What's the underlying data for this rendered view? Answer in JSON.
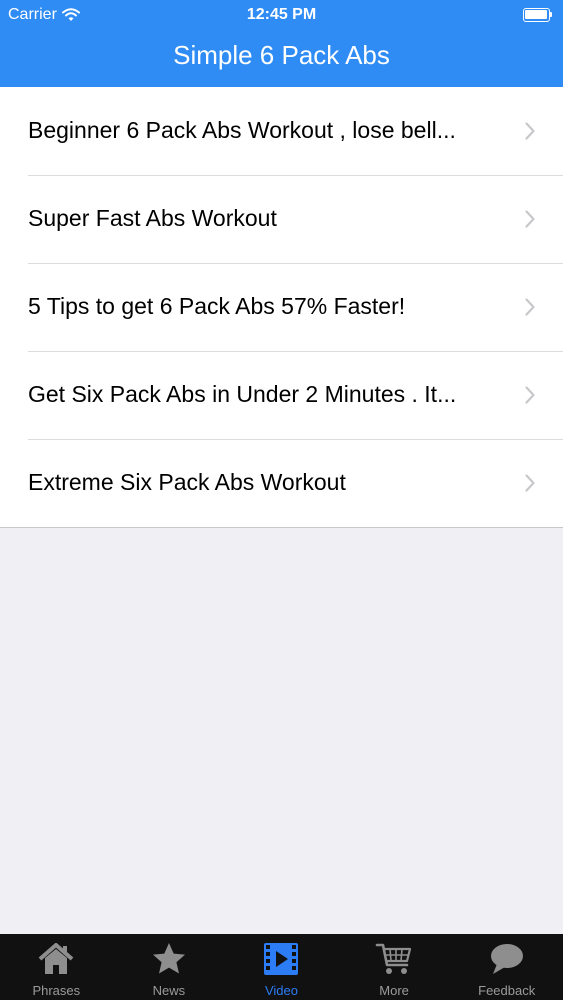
{
  "status_bar": {
    "carrier": "Carrier",
    "time": "12:45 PM"
  },
  "nav": {
    "title": "Simple 6 Pack Abs"
  },
  "list": {
    "items": [
      {
        "label": "Beginner 6 Pack Abs Workout , lose bell..."
      },
      {
        "label": "Super Fast Abs Workout"
      },
      {
        "label": "5 Tips to get 6 Pack Abs 57% Faster!"
      },
      {
        "label": "Get Six Pack Abs in Under 2 Minutes . It..."
      },
      {
        "label": "Extreme Six Pack Abs Workout"
      }
    ]
  },
  "tabs": {
    "items": [
      {
        "label": "Phrases",
        "icon": "home-icon"
      },
      {
        "label": "News",
        "icon": "star-icon"
      },
      {
        "label": "Video",
        "icon": "film-icon",
        "active": true
      },
      {
        "label": "More",
        "icon": "cart-icon"
      },
      {
        "label": "Feedback",
        "icon": "speech-bubble-icon"
      }
    ]
  },
  "colors": {
    "nav_background": "#2f8cf5",
    "active_tab": "#2b7cf5",
    "tab_bar_background": "#111111",
    "page_background": "#efeff4"
  }
}
